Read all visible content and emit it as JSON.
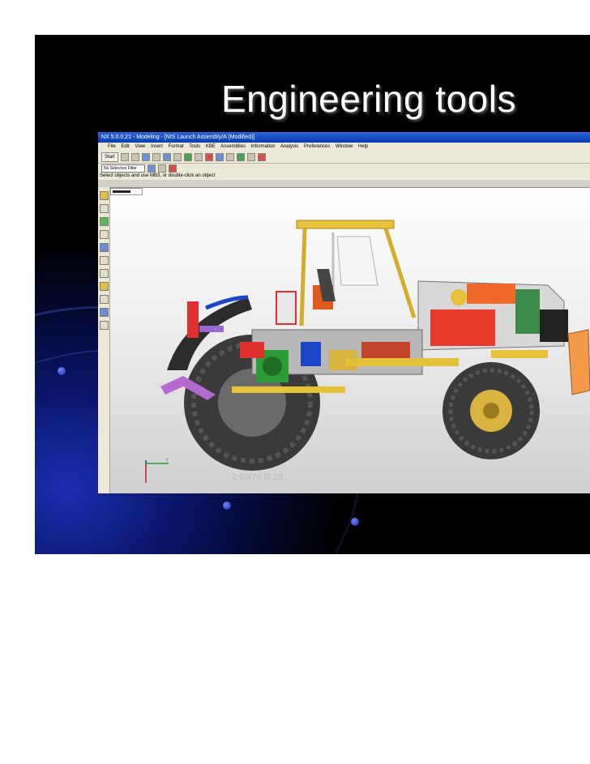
{
  "slide": {
    "title": "Engineering tools"
  },
  "app": {
    "window_title": "NX 5.0.0.21 - Modeling - [NIS Launch Assembly/A (Modified)]",
    "menu": [
      "File",
      "Edit",
      "View",
      "Insert",
      "Format",
      "Tools",
      "KBE",
      "Assemblies",
      "Information",
      "Analysis",
      "Preferences",
      "Window",
      "Help"
    ],
    "start_label": "Start",
    "selection_filter": "No Selection Filter",
    "cue_line": "Select objects and use MB3, or double-click an object",
    "triad_y_label": "Y"
  },
  "colors": {
    "slide_bg": "#000000",
    "accent_blue": "#1a2fb0",
    "titlebar": "#0a3cb0",
    "chrome": "#ece9d8"
  },
  "model": {
    "tire_label": "2.60/70 R 28"
  }
}
